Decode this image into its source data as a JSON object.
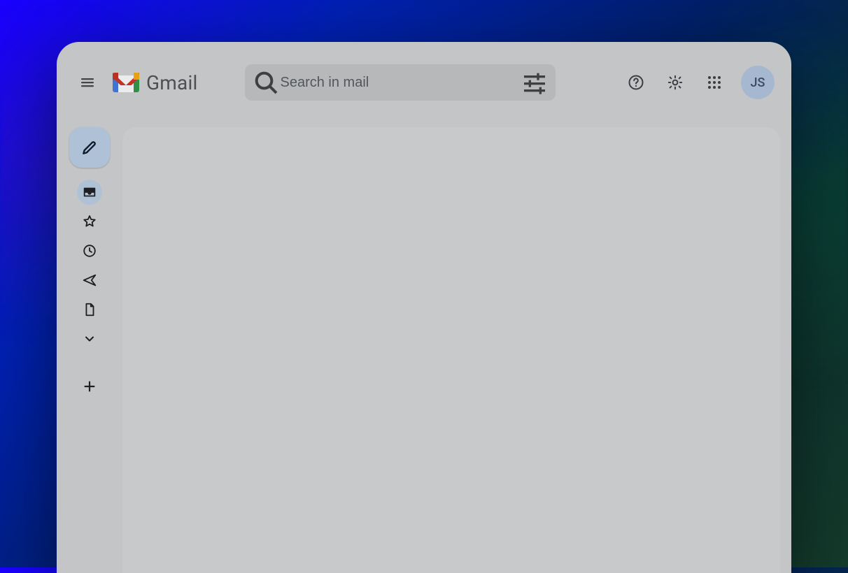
{
  "brand": {
    "name": "Gmail"
  },
  "search": {
    "placeholder": "Search in mail",
    "value": ""
  },
  "avatar": {
    "initials": "JS"
  }
}
